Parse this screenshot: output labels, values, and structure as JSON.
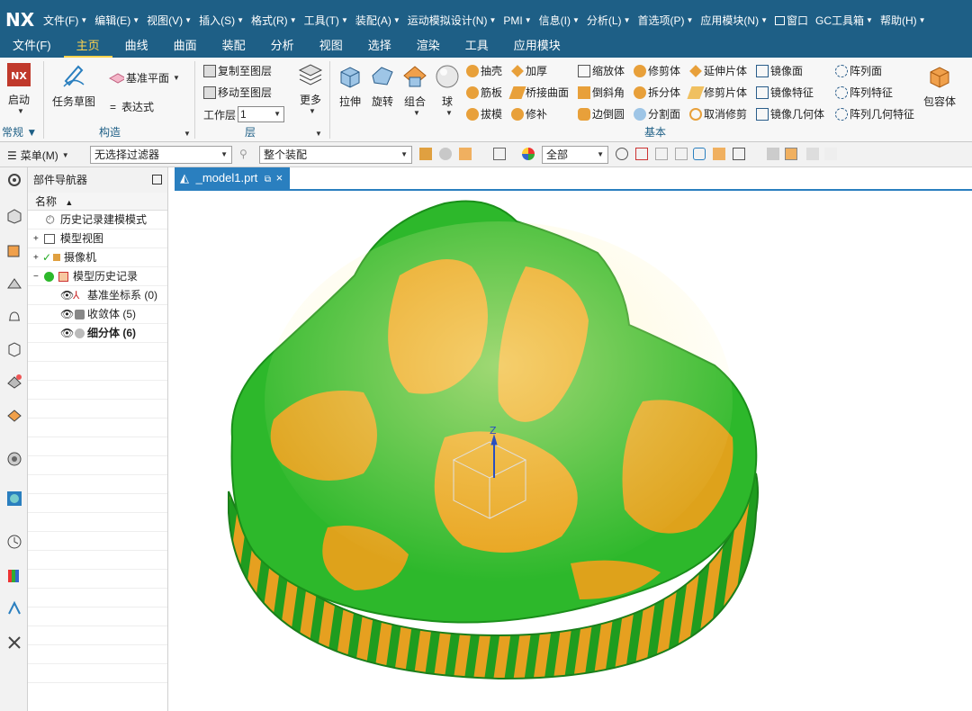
{
  "app": {
    "logo": "NX"
  },
  "menubar": {
    "items": [
      "文件(F)",
      "编辑(E)",
      "视图(V)",
      "插入(S)",
      "格式(R)",
      "工具(T)",
      "装配(A)",
      "运动模拟设计(N)",
      "PMI",
      "信息(I)",
      "分析(L)",
      "首选项(P)",
      "应用模块(N)",
      "窗口",
      "GC工具箱",
      "帮助(H)"
    ]
  },
  "ribbon_tabs": [
    "文件(F)",
    "主页",
    "曲线",
    "曲面",
    "装配",
    "分析",
    "视图",
    "选择",
    "渲染",
    "工具",
    "应用模块"
  ],
  "ribbon": {
    "start": {
      "label": "启动"
    },
    "construct": {
      "task_sketch": "任务草图",
      "datum_plane": "基准平面",
      "expression": "表达式",
      "group_label": "构造"
    },
    "layer": {
      "copy_to_layer": "复制至图层",
      "move_to_layer": "移动至图层",
      "work_layer_label": "工作层",
      "work_layer_value": "1",
      "more": "更多",
      "group_label": "层"
    },
    "basic": {
      "extrude": "拉伸",
      "revolve": "旋转",
      "combine": "组合",
      "sphere": "球",
      "shell": "抽壳",
      "thicken": "加厚",
      "rib": "筋板",
      "bridge_surface": "桥接曲面",
      "draft": "拔模",
      "patch": "修补",
      "scale_body": "缩放体",
      "trim_body": "修剪体",
      "extend_sheet": "延伸片体",
      "mirror_face": "镜像面",
      "chamfer": "倒斜角",
      "split_body": "拆分体",
      "trim_sheet": "修剪片体",
      "mirror_feature": "镜像特征",
      "edge_blend": "边倒圆",
      "divide_face": "分割面",
      "cancel_trim": "取消修剪",
      "mirror_geometry": "镜像几何体",
      "pattern_face": "阵列面",
      "pattern_geometry": "阵列几何特征",
      "pattern_feature": "阵列特征",
      "bounding_body": "包容体",
      "group_label": "基本"
    },
    "general_label": "常规"
  },
  "selection_bar": {
    "menu": "菜单(M)",
    "filter": "无选择过滤器",
    "scope": "整个装配",
    "all": "全部"
  },
  "navigator": {
    "title": "部件导航器",
    "column": "名称",
    "rows": [
      {
        "label": "历史记录建模模式"
      },
      {
        "label": "模型视图"
      },
      {
        "label": "摄像机"
      },
      {
        "label": "模型历史记录"
      },
      {
        "label": "基准坐标系 (0)"
      },
      {
        "label": "收敛体 (5)"
      },
      {
        "label": "细分体 (6)"
      }
    ]
  },
  "document": {
    "tab_title": "_model1.prt"
  },
  "colors": {
    "titlebar": "#1e5f86",
    "accent": "#ffd34d",
    "doc_tab": "#2a7fbf",
    "model_green": "#2db82b",
    "model_orange": "#f2a01a"
  },
  "model": {
    "triad_axis_label": "Z"
  }
}
